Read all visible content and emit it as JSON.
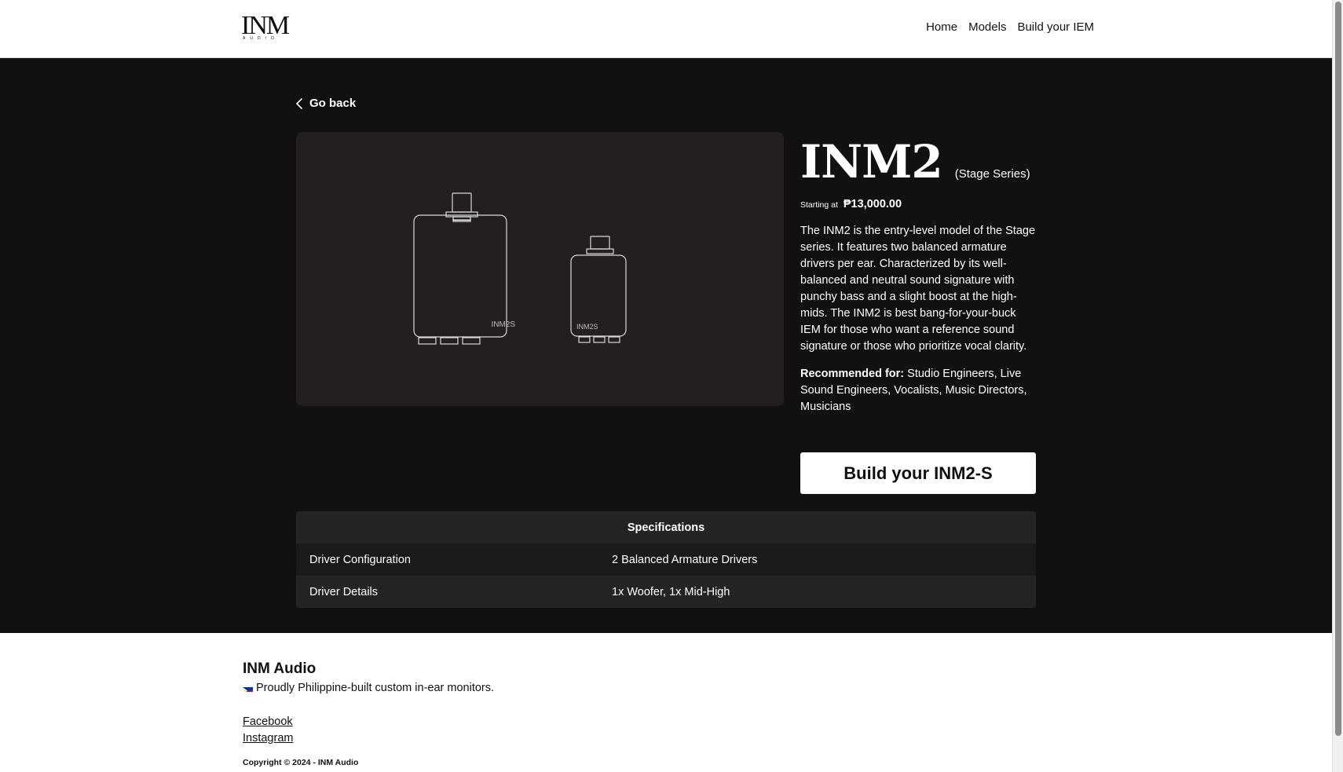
{
  "header": {
    "logo_text": "INM",
    "logo_sub": "AUDIO",
    "nav": {
      "home": "Home",
      "models": "Models",
      "build": "Build your IEM"
    }
  },
  "main": {
    "go_back": "Go back",
    "product": {
      "title": "INM2",
      "series": "(Stage Series)",
      "price_label": "Starting at",
      "price": "₱13,000.00",
      "description": "The INM2 is the entry-level model of the Stage series. It features two balanced armature drivers per ear. Characterized by its well-balanced and neutral sound signature with punchy bass and a slight boost at the high-mids. The INM2 is best bang-for-your-buck IEM for those who want a reference sound signature or those who prioritize vocal clarity.",
      "recommended_label": "Recommended for:",
      "recommended_value": " Studio Engineers, Live Sound Engineers, Vocalists, Music Directors, Musicians",
      "image_labels": {
        "large": "INM2S",
        "small": "INM2S"
      }
    },
    "build_button": "Build your INM2-S",
    "specs": {
      "heading": "Specifications",
      "rows": [
        {
          "key": "Driver Configuration",
          "value": "2 Balanced Armature Drivers"
        },
        {
          "key": "Driver Details",
          "value": "1x Woofer, 1x Mid-High"
        }
      ]
    }
  },
  "footer": {
    "brand": "INM Audio",
    "tagline": "Proudly Philippine-built custom in-ear monitors.",
    "links": {
      "facebook": "Facebook",
      "instagram": "Instagram"
    },
    "copyright": "Copyright © 2024 - INM Audio"
  },
  "colors": {
    "main_bg": "#111111",
    "card_bg": "#231f20",
    "spec_row_dark": "#1a1a1a",
    "spec_row_light": "#242424",
    "flag_blue": "#0038a8",
    "flag_red": "#ce1126"
  }
}
